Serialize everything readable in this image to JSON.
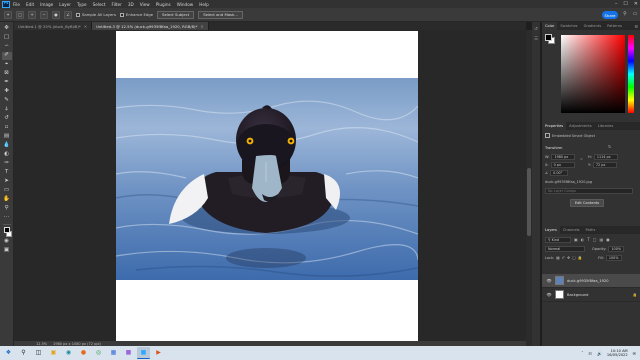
{
  "app": {
    "logo": "Ps"
  },
  "menu": [
    "File",
    "Edit",
    "Image",
    "Layer",
    "Type",
    "Select",
    "Filter",
    "3D",
    "View",
    "Plugins",
    "Window",
    "Help"
  ],
  "window_controls": [
    "minimize-icon",
    "maximize-icon",
    "close-icon"
  ],
  "options_bar": {
    "sample_all_layers": "Sample All Layers",
    "enhance_edge": "Enhance Edge",
    "select_subject": "Select Subject",
    "select_and_mask": "Select and Mask...",
    "share": "Share"
  },
  "tabs": [
    {
      "label": "Untitled-1 @ 25% (duck_ByBi/8)*",
      "active": false
    },
    {
      "label": "Untitled-3 @ 12.5% (duck-g9935f8faa_1920, RGB/8)*",
      "active": true
    }
  ],
  "status": {
    "zoom": "12.5%",
    "doc": "1980 px x 1080 px (72 ppi)"
  },
  "color_panel": {
    "tabs": [
      "Color",
      "Swatches",
      "Gradients",
      "Patterns"
    ],
    "active": "Color",
    "accent": "#ff0000"
  },
  "properties": {
    "tabs": [
      "Properties",
      "Adjustments",
      "Libraries"
    ],
    "active": "Properties",
    "kind": "Embedded Smart Object",
    "section": "Transform",
    "w_label": "W:",
    "w": "1980 px",
    "h_label": "H:",
    "h": "1114 px",
    "x_label": "X:",
    "x": "0 px",
    "y_label": "Y:",
    "y": "72 px",
    "angle": "0.00°",
    "filename": "duck-g9935f8faa_1920.jpg",
    "placeholder": "No Layer Comps",
    "edit_btn": "Edit Contents"
  },
  "layers": {
    "tabs": [
      "Layers",
      "Channels",
      "Paths"
    ],
    "active": "Layers",
    "kind": "Kind",
    "blend": "Normal",
    "opacity_label": "Opacity:",
    "opacity": "100%",
    "lock_label": "Lock:",
    "fill_label": "Fill:",
    "fill": "100%",
    "items": [
      {
        "name": "duck-g9935f8faa_1920",
        "selected": true
      },
      {
        "name": "Background",
        "selected": false
      }
    ]
  },
  "taskbar": {
    "apps": [
      "windows-start-icon",
      "search-icon",
      "task-view-icon",
      "file-explorer-icon",
      "edge-icon",
      "firefox-icon",
      "chrome-icon",
      "store-icon",
      "premiere-icon",
      "photoshop-icon",
      "media-player-icon"
    ],
    "time": "10:10 AM",
    "date": "16/05/2022"
  }
}
